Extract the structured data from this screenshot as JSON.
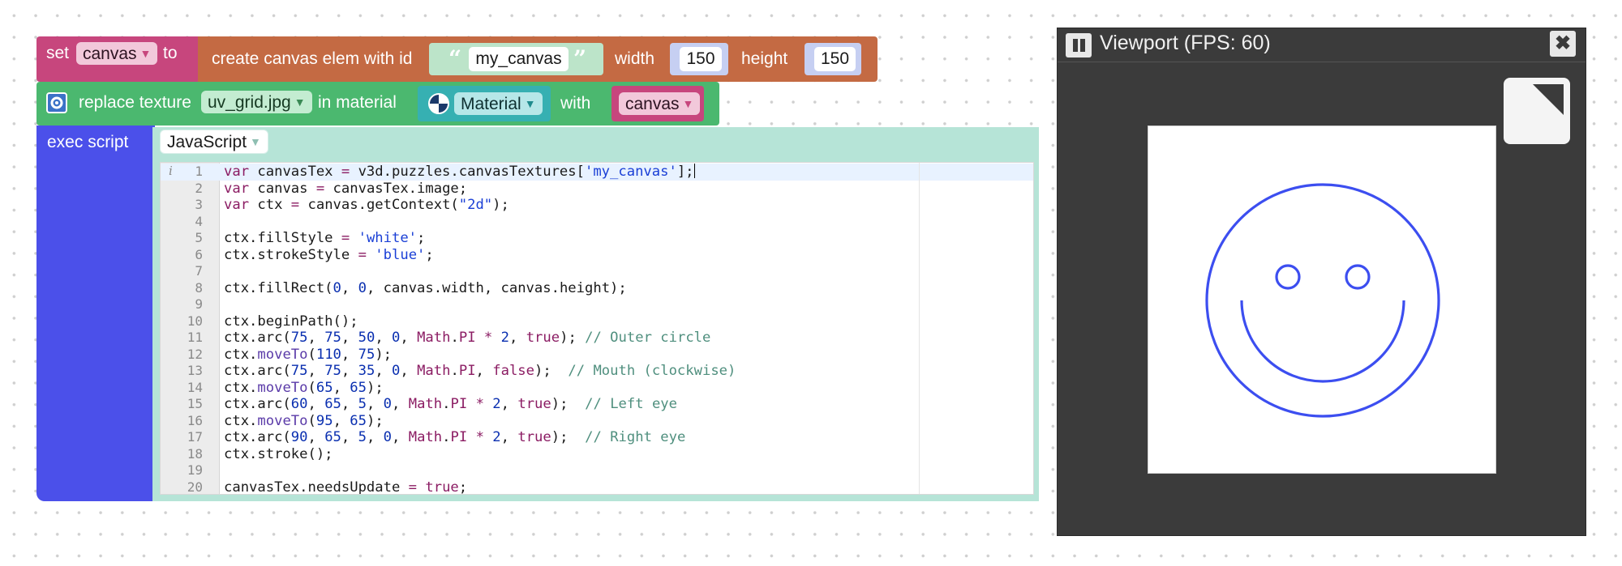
{
  "set_block": {
    "label_set": "set",
    "variable": "canvas",
    "label_to": "to"
  },
  "create_block": {
    "label": "create canvas elem with id",
    "id_value": "my_canvas",
    "label_width": "width",
    "width_value": "150",
    "label_height": "height",
    "height_value": "150"
  },
  "replace_block": {
    "label_replace": "replace texture",
    "texture": "uv_grid.jpg",
    "label_in_material": "in material",
    "material": "Material",
    "label_with": "with",
    "with_variable": "canvas"
  },
  "exec_block": {
    "label": "exec script",
    "language": "JavaScript"
  },
  "editor": {
    "line_numbers": [
      "1",
      "2",
      "3",
      "4",
      "5",
      "6",
      "7",
      "8",
      "9",
      "10",
      "11",
      "12",
      "13",
      "14",
      "15",
      "16",
      "17",
      "18",
      "19",
      "20"
    ],
    "info_marker": "i",
    "lines": [
      "var canvasTex = v3d.puzzles.canvasTextures['my_canvas'];",
      "var canvas = canvasTex.image;",
      "var ctx = canvas.getContext(\"2d\");",
      "",
      "ctx.fillStyle = 'white';",
      "ctx.strokeStyle = 'blue';",
      "",
      "ctx.fillRect(0, 0, canvas.width, canvas.height);",
      "",
      "ctx.beginPath();",
      "ctx.arc(75, 75, 50, 0, Math.PI * 2, true); // Outer circle",
      "ctx.moveTo(110, 75);",
      "ctx.arc(75, 75, 35, 0, Math.PI, false);  // Mouth (clockwise)",
      "ctx.moveTo(65, 65);",
      "ctx.arc(60, 65, 5, 0, Math.PI * 2, true);  // Left eye",
      "ctx.moveTo(95, 65);",
      "ctx.arc(90, 65, 5, 0, Math.PI * 2, true);  // Right eye",
      "ctx.stroke();",
      "",
      "canvasTex.needsUpdate = true;"
    ]
  },
  "viewport": {
    "title": "Viewport (FPS: 60)",
    "close_glyph": "✖",
    "icons": [
      "pause-icon",
      "close-icon",
      "fullscreen-icon"
    ]
  },
  "colors": {
    "set_block": "#c7467d",
    "create_block": "#c46a43",
    "replace_block": "#4bb86f",
    "exec_block": "#4b50ea",
    "exec_body": "#b6e4d7",
    "smiley_stroke": "#3c4ef0"
  }
}
